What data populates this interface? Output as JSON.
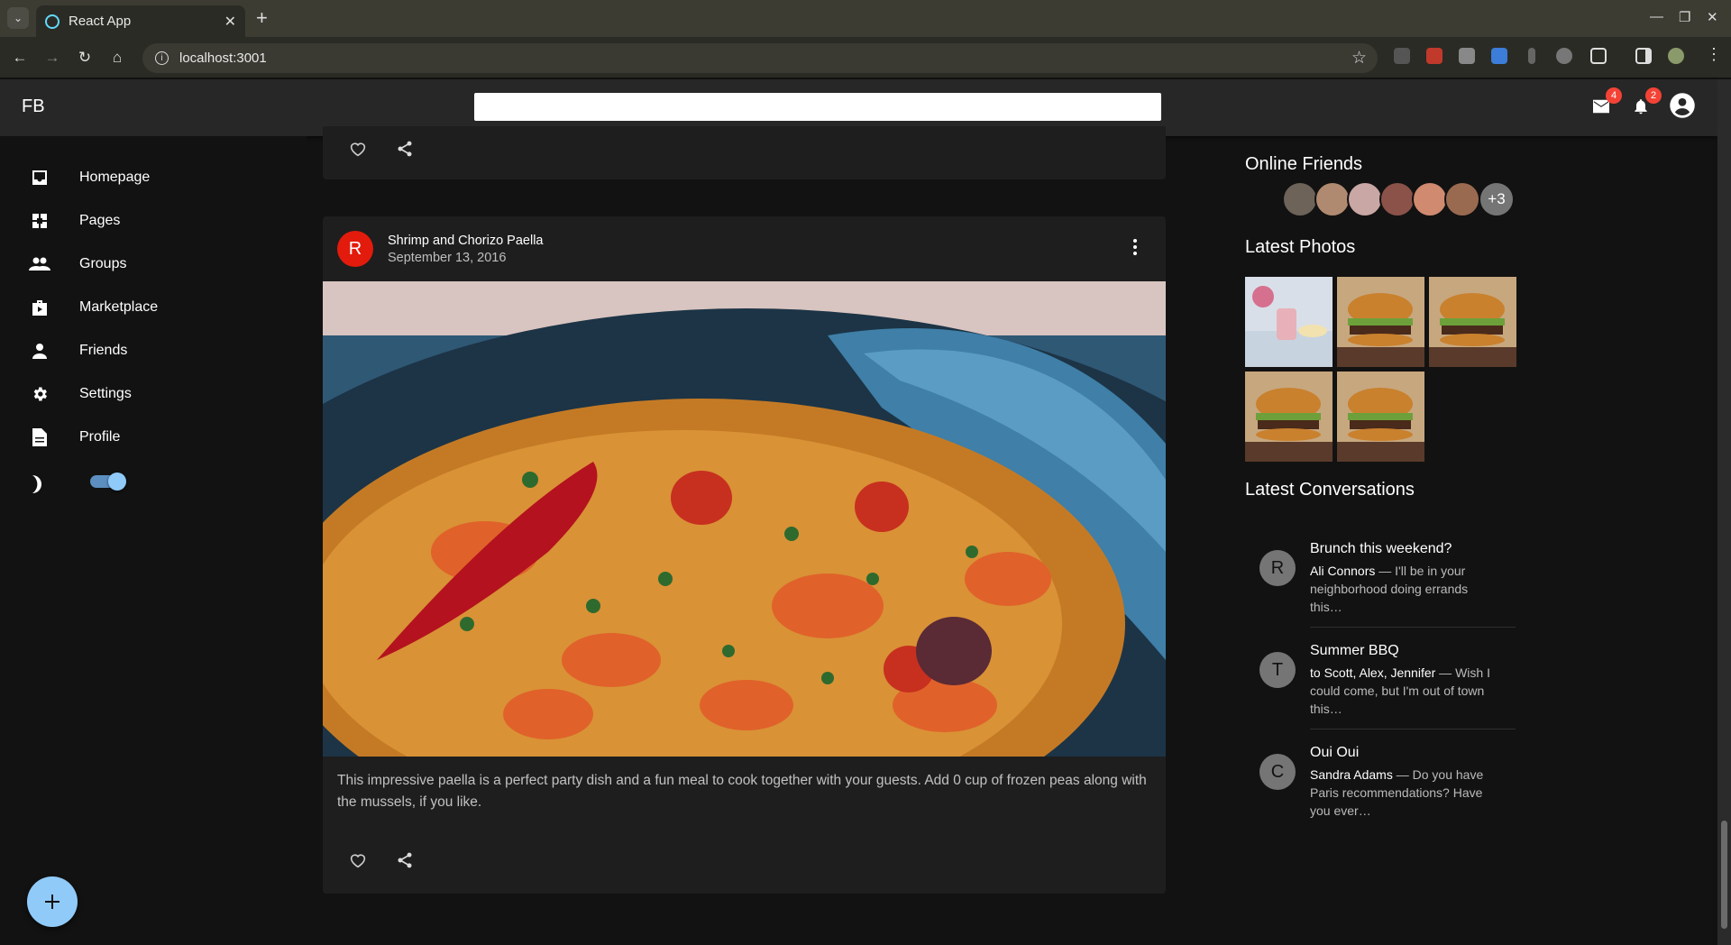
{
  "browser": {
    "tab_title": "React App",
    "url": "localhost:3001"
  },
  "appbar": {
    "logo": "FB",
    "search_placeholder": "",
    "mail_count": "4",
    "notif_count": "2"
  },
  "sidebar": {
    "items": [
      {
        "label": "Homepage",
        "icon": "inbox-icon"
      },
      {
        "label": "Pages",
        "icon": "pages-icon"
      },
      {
        "label": "Groups",
        "icon": "group-icon"
      },
      {
        "label": "Marketplace",
        "icon": "storefront-icon"
      },
      {
        "label": "Friends",
        "icon": "person-icon"
      },
      {
        "label": "Settings",
        "icon": "settings-icon"
      },
      {
        "label": "Profile",
        "icon": "article-icon"
      }
    ],
    "dark_mode": true
  },
  "post": {
    "avatar_letter": "R",
    "title": "Shrimp and Chorizo Paella",
    "date": "September 13, 2016",
    "description": "This impressive paella is a perfect party dish and a fun meal to cook together with your guests. Add 0 cup of frozen peas along with the mussels, if you like."
  },
  "rightbar": {
    "online_friends_title": "Online Friends",
    "online_more": "+3",
    "latest_photos_title": "Latest Photos",
    "latest_conversations_title": "Latest Conversations",
    "conversations": [
      {
        "letter": "R",
        "title": "Brunch this weekend?",
        "from": "Ali Connors",
        "snippet": " — I'll be in your neighborhood doing errands this…"
      },
      {
        "letter": "T",
        "title": "Summer BBQ",
        "from": "to Scott, Alex, Jennifer",
        "snippet": " — Wish I could come, but I'm out of town this…"
      },
      {
        "letter": "C",
        "title": "Oui Oui",
        "from": "Sandra Adams",
        "snippet": " — Do you have Paris recommendations? Have you ever…"
      }
    ]
  },
  "colors": {
    "accent": "#90caf9",
    "avatar_red": "#e31b0c",
    "badge": "#f44336",
    "card": "#1e1e1e"
  }
}
